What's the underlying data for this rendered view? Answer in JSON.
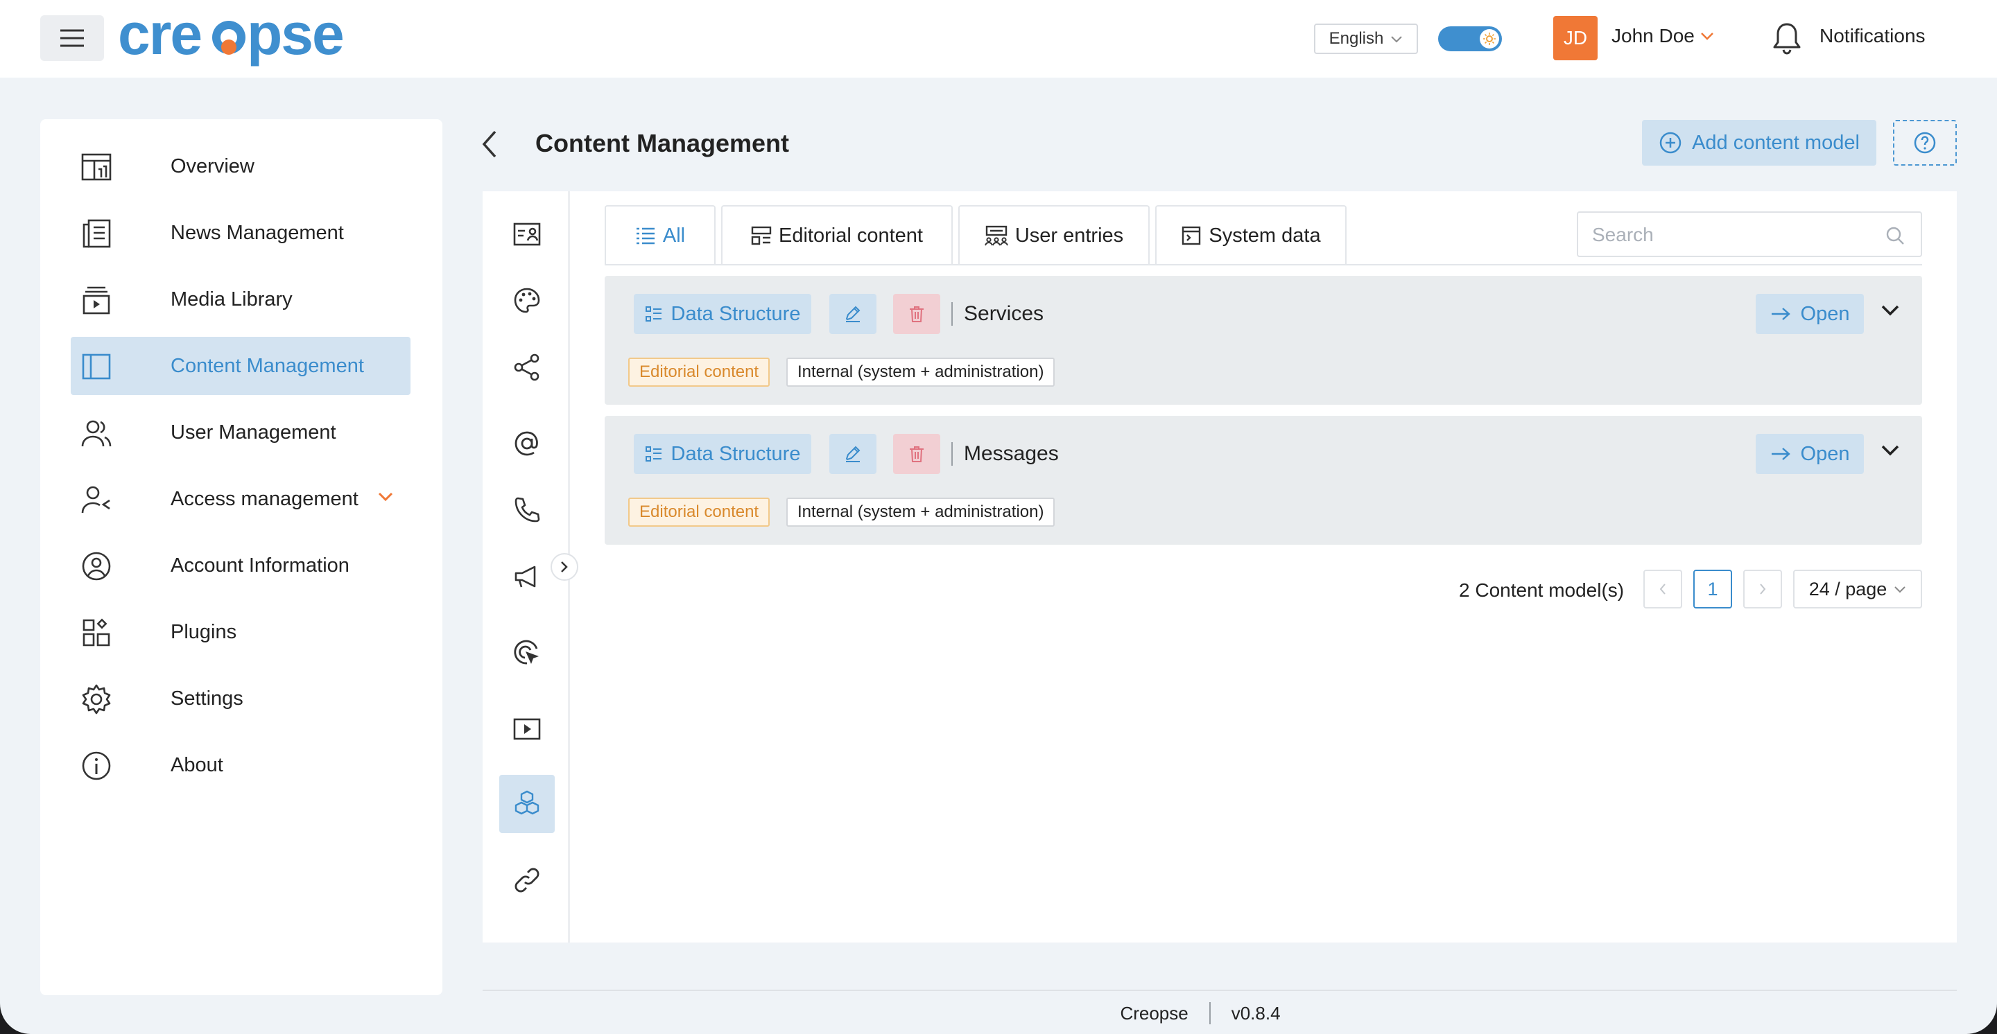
{
  "header": {
    "brand": "creopse",
    "language": "English",
    "user_initials": "JD",
    "user_name": "John Doe",
    "notifications_label": "Notifications"
  },
  "sidebar": {
    "items": [
      {
        "label": "Overview",
        "icon": "overview-icon"
      },
      {
        "label": "News Management",
        "icon": "news-icon"
      },
      {
        "label": "Media Library",
        "icon": "media-icon"
      },
      {
        "label": "Content Management",
        "icon": "content-icon",
        "active": true
      },
      {
        "label": "User Management",
        "icon": "users-icon"
      },
      {
        "label": "Access management",
        "icon": "access-icon",
        "expandable": true
      },
      {
        "label": "Account Information",
        "icon": "account-icon"
      },
      {
        "label": "Plugins",
        "icon": "plugins-icon"
      },
      {
        "label": "Settings",
        "icon": "gear-icon"
      },
      {
        "label": "About",
        "icon": "info-icon"
      }
    ]
  },
  "main": {
    "title": "Content Management",
    "add_button": "Add content model",
    "tabs": [
      {
        "label": "All",
        "icon": "list-icon",
        "active": true
      },
      {
        "label": "Editorial content",
        "icon": "layout-icon"
      },
      {
        "label": "User entries",
        "icon": "user-entries-icon"
      },
      {
        "label": "System data",
        "icon": "terminal-icon"
      }
    ],
    "search_placeholder": "Search",
    "rows": [
      {
        "button": "Data Structure",
        "title": "Services",
        "open": "Open",
        "tag_type": "Editorial content",
        "tag_scope": "Internal (system + administration)"
      },
      {
        "button": "Data Structure",
        "title": "Messages",
        "open": "Open",
        "tag_type": "Editorial content",
        "tag_scope": "Internal (system + administration)"
      }
    ],
    "count_label": "2 Content model(s)",
    "current_page": "1",
    "per_page": "24 / page"
  },
  "footer": {
    "app": "Creopse",
    "version": "v0.8.4"
  },
  "colors": {
    "accent": "#3a8ccc",
    "accent_bg": "#cfe1f0",
    "avatar": "#f07836",
    "danger_bg": "#f2cfd3",
    "warning_text": "#d9892c"
  }
}
